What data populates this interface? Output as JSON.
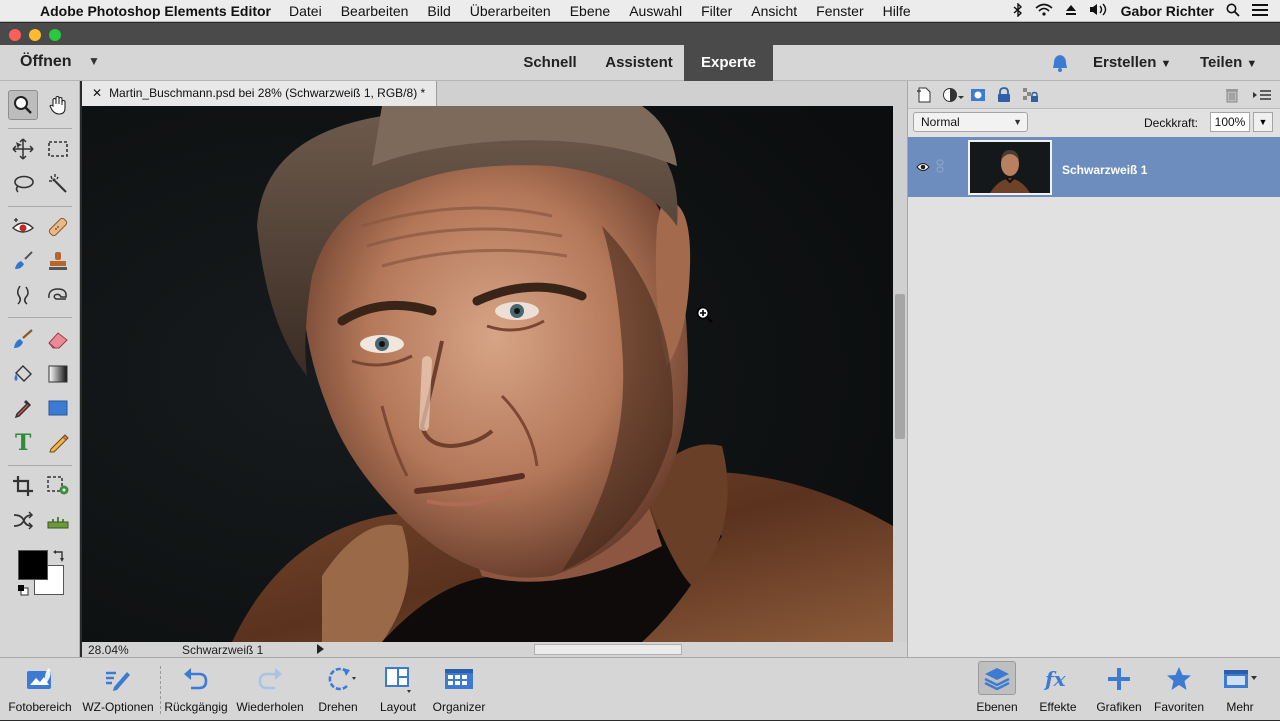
{
  "menubar": {
    "app": "Adobe Photoshop Elements Editor",
    "items": [
      "Datei",
      "Bearbeiten",
      "Bild",
      "Überarbeiten",
      "Ebene",
      "Auswahl",
      "Filter",
      "Ansicht",
      "Fenster",
      "Hilfe"
    ],
    "user": "Gabor Richter"
  },
  "topbar": {
    "open_label": "Öffnen",
    "modes": [
      "Schnell",
      "Assistent",
      "Experte"
    ],
    "active_mode": "Experte",
    "create_label": "Erstellen",
    "share_label": "Teilen"
  },
  "document": {
    "tab_title": "Martin_Buschmann.psd bei 28% (Schwarzweiß 1, RGB/8) *",
    "zoom": "28.04%",
    "status_layer": "Schwarzweiß 1"
  },
  "layers_panel": {
    "blend_mode": "Normal",
    "opacity_label": "Deckkraft:",
    "opacity_value": "100%",
    "layer_name": "Schwarzweiß 1"
  },
  "bottombar": {
    "left": [
      "Fotobereich",
      "WZ-Optionen",
      "Rückgängig",
      "Wiederholen",
      "Drehen",
      "Layout",
      "Organizer"
    ],
    "right": [
      "Ebenen",
      "Effekte",
      "Grafiken",
      "Favoriten",
      "Mehr"
    ],
    "selected": "Ebenen"
  },
  "colors": {
    "accent": "#6c8dbd",
    "active_tab": "#4a4a4a",
    "panel_bg": "#d6d6d6",
    "icon_blue": "#3d7bd3"
  }
}
